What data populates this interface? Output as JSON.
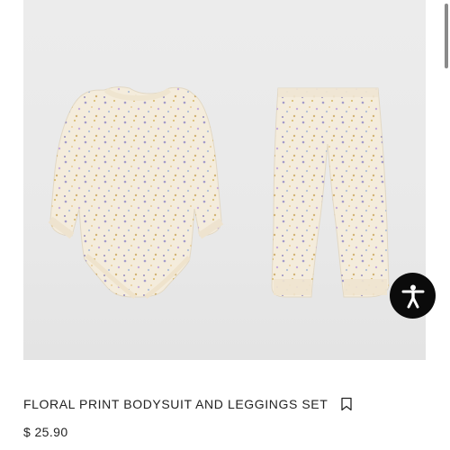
{
  "product": {
    "title": "FLORAL PRINT BODYSUIT AND LEGGINGS SET",
    "price": "$ 25.90",
    "image_alt": "Floral print bodysuit and leggings set"
  },
  "icons": {
    "bookmark": "bookmark-icon",
    "accessibility": "accessibility-icon"
  },
  "colors": {
    "background": "#ffffff",
    "image_background": "#ebebeb",
    "garment": "#f4ecdc",
    "accessibility_button": "#0b0b0b"
  }
}
